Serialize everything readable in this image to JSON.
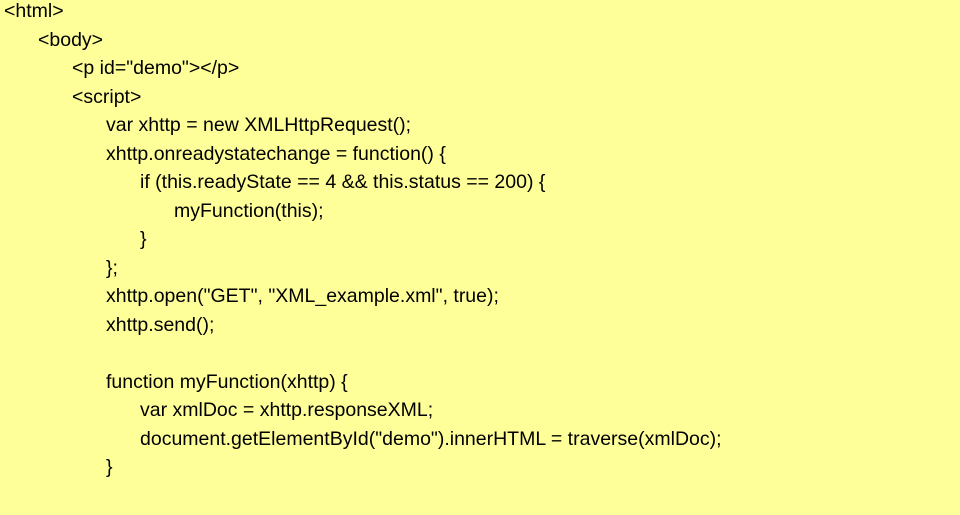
{
  "colors": {
    "background": "#ffff99",
    "text": "#000000"
  },
  "code": {
    "lines": [
      {
        "indent": 0,
        "text": "<html>"
      },
      {
        "indent": 1,
        "text": "<body>"
      },
      {
        "indent": 2,
        "text": "<p id=\"demo\"></p>"
      },
      {
        "indent": 2,
        "text": "<script>"
      },
      {
        "indent": 3,
        "text": "var xhttp = new XMLHttpRequest();"
      },
      {
        "indent": 3,
        "text": "xhttp.onreadystatechange = function() {"
      },
      {
        "indent": 4,
        "text": "if (this.readyState == 4 && this.status == 200) {"
      },
      {
        "indent": 5,
        "text": "myFunction(this);"
      },
      {
        "indent": 4,
        "text": "}"
      },
      {
        "indent": 3,
        "text": "};"
      },
      {
        "indent": 3,
        "text": "xhttp.open(\"GET\", \"XML_example.xml\", true);"
      },
      {
        "indent": 3,
        "text": "xhttp.send();"
      },
      {
        "indent": 3,
        "text": ""
      },
      {
        "indent": 3,
        "text": "function myFunction(xhttp) {"
      },
      {
        "indent": 4,
        "text": "var xmlDoc = xhttp.responseXML;"
      },
      {
        "indent": 4,
        "text": "document.getElementById(\"demo\").innerHTML = traverse(xmlDoc);"
      },
      {
        "indent": 3,
        "text": "}"
      }
    ]
  }
}
